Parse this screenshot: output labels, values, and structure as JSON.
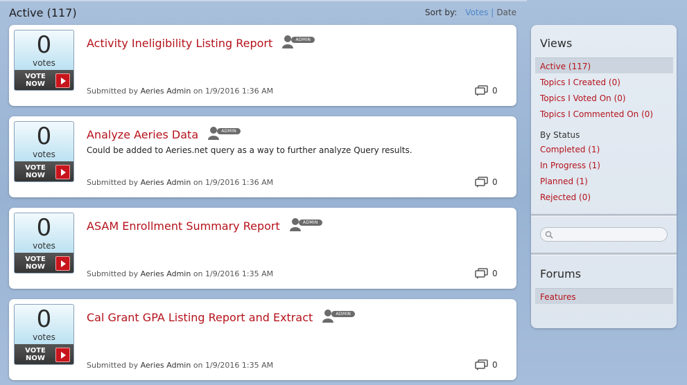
{
  "list": {
    "title": "Active (117)",
    "sort_label": "Sort by:",
    "sort_options": [
      "Votes",
      "Date"
    ],
    "sort_separator": "|"
  },
  "topics": [
    {
      "votes": "0",
      "votes_label": "votes",
      "vote_button": [
        "VOTE",
        "NOW"
      ],
      "title": "Activity Ineligibility Listing Report",
      "badge": "ADMIN",
      "description": "",
      "submitted_prefix": "Submitted by",
      "author": "Aeries Admin",
      "date_text": "on 1/9/2016 1:36 AM",
      "comments": "0"
    },
    {
      "votes": "0",
      "votes_label": "votes",
      "vote_button": [
        "VOTE",
        "NOW"
      ],
      "title": "Analyze Aeries Data",
      "badge": "ADMIN",
      "description": "Could be added to Aeries.net query as a way to further analyze Query results.",
      "submitted_prefix": "Submitted by",
      "author": "Aeries Admin",
      "date_text": "on 1/9/2016 1:36 AM",
      "comments": "0"
    },
    {
      "votes": "0",
      "votes_label": "votes",
      "vote_button": [
        "VOTE",
        "NOW"
      ],
      "title": "ASAM Enrollment Summary Report",
      "badge": "ADMIN",
      "description": "",
      "submitted_prefix": "Submitted by",
      "author": "Aeries Admin",
      "date_text": "on 1/9/2016 1:35 AM",
      "comments": "0"
    },
    {
      "votes": "0",
      "votes_label": "votes",
      "vote_button": [
        "VOTE",
        "NOW"
      ],
      "title": "Cal Grant GPA Listing Report and Extract",
      "badge": "ADMIN",
      "description": "",
      "submitted_prefix": "Submitted by",
      "author": "Aeries Admin",
      "date_text": "on 1/9/2016 1:35 AM",
      "comments": "0"
    }
  ],
  "sidebar": {
    "views_heading": "Views",
    "views": [
      "Active (117)",
      "Topics I Created (0)",
      "Topics I Voted On (0)",
      "Topics I Commented On (0)"
    ],
    "status_heading": "By Status",
    "statuses": [
      "Completed (1)",
      "In Progress (1)",
      "Planned (1)",
      "Rejected (0)"
    ],
    "search_placeholder": "",
    "forums_heading": "Forums",
    "forums": [
      "Features"
    ]
  },
  "colors": {
    "link": "#b5121b",
    "sort_active": "#4f86c9",
    "vote_arrow": "#c8141c"
  }
}
